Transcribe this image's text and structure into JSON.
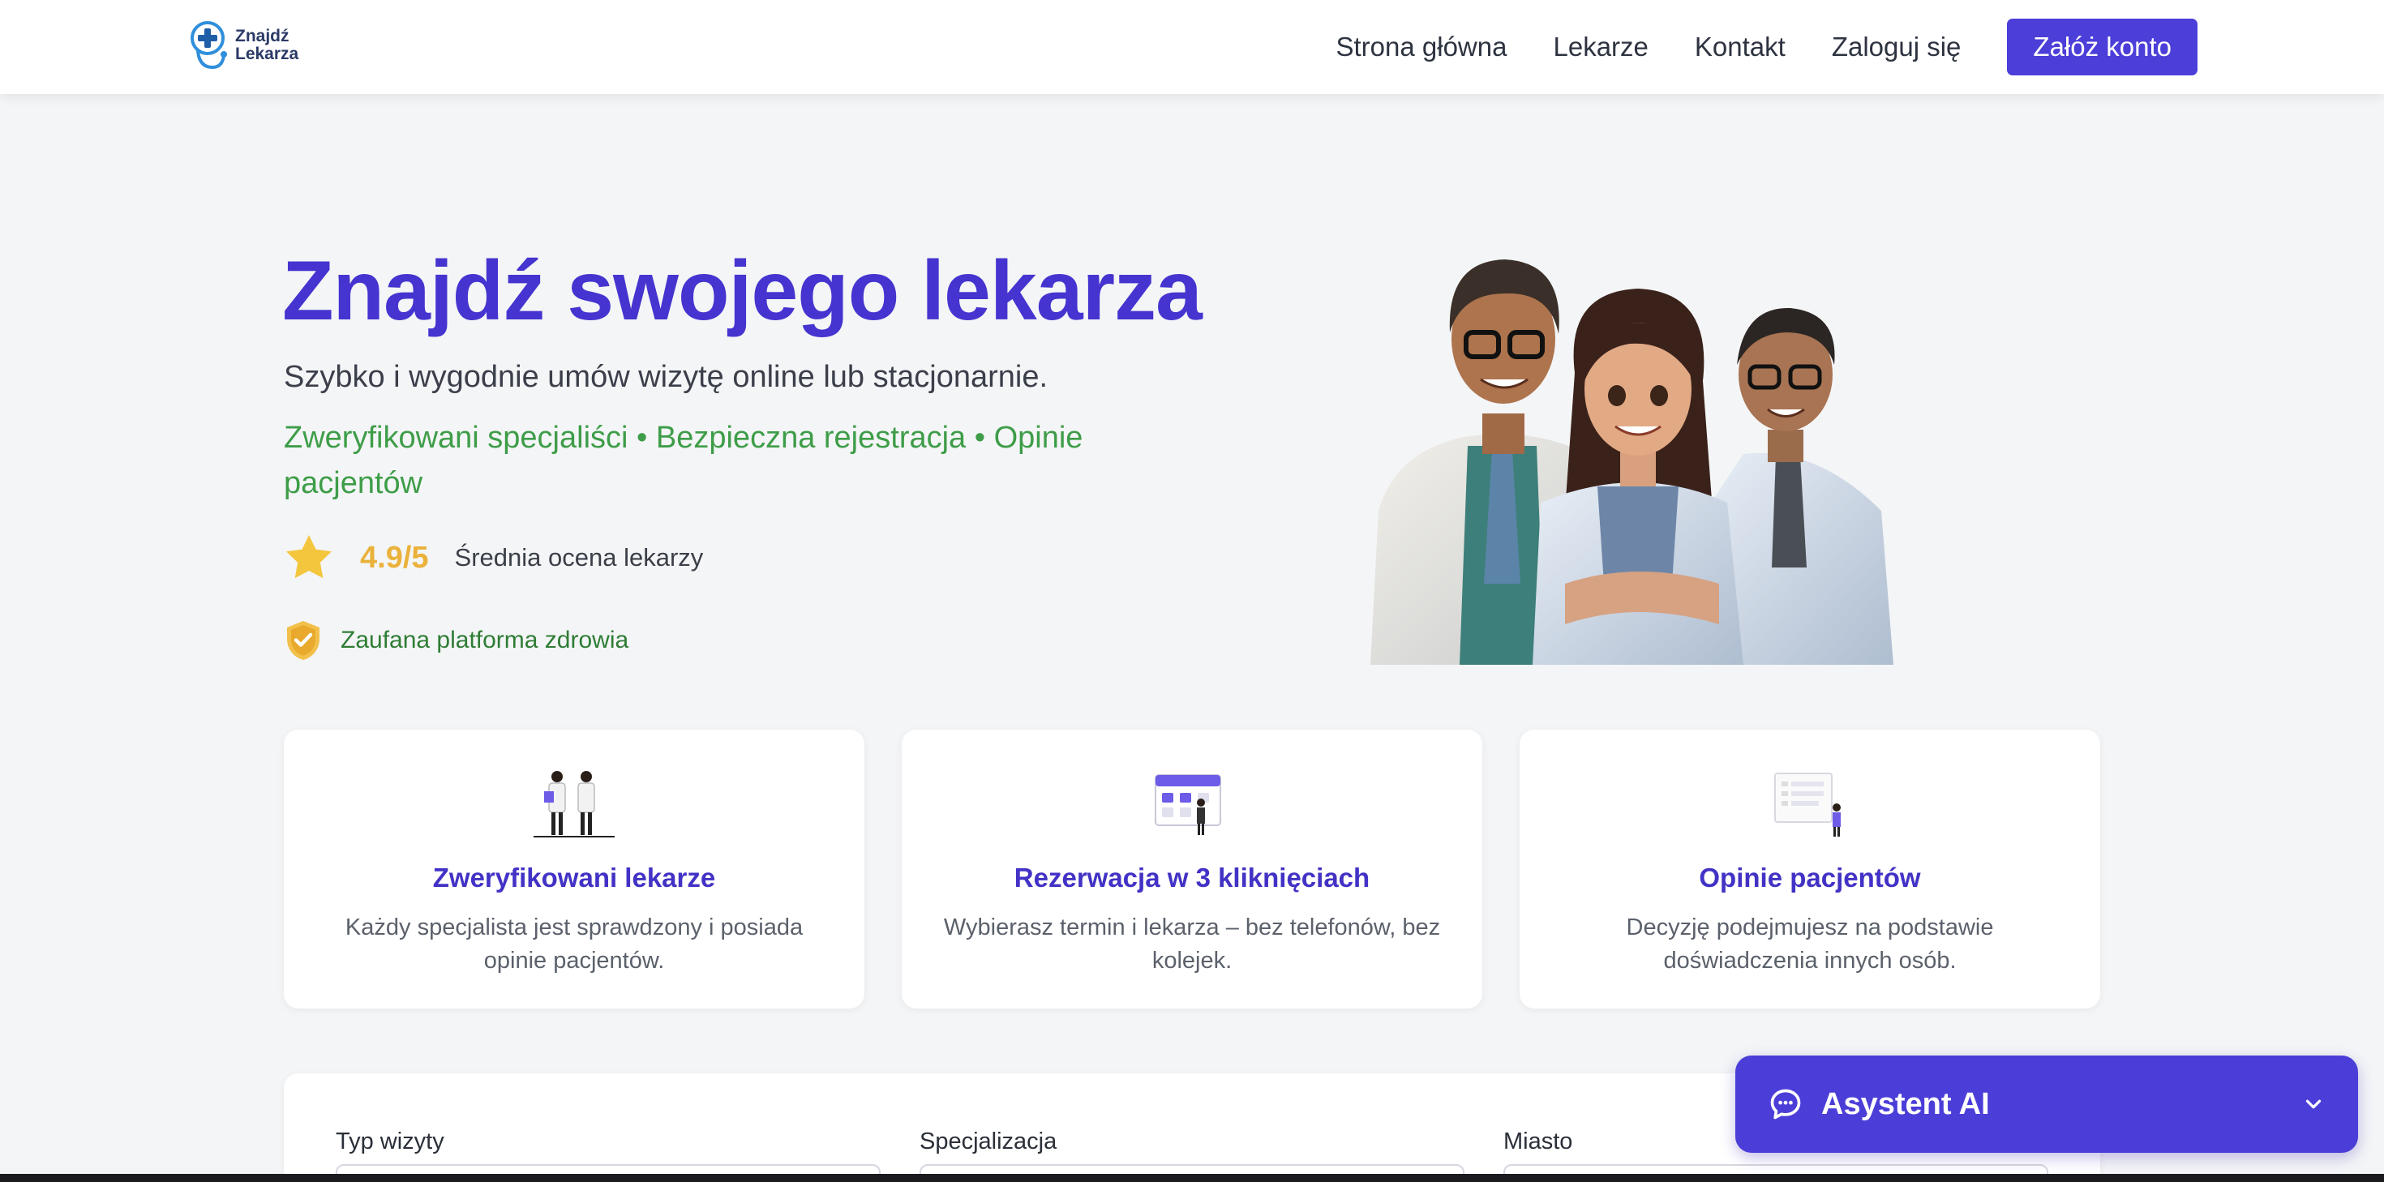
{
  "header": {
    "logo_line1": "Znajdź",
    "logo_line2": "Lekarza",
    "nav": [
      "Strona główna",
      "Lekarze",
      "Kontakt",
      "Zaloguj się"
    ],
    "cta": "Załóż konto"
  },
  "hero": {
    "title": "Znajdź swojego lekarza",
    "subtitle": "Szybko i wygodnie umów wizytę online lub stacjonarnie.",
    "features": "Zweryfikowani specjaliści • Bezpieczna rejestracja • Opinie pacjentów",
    "rating_value": "4.9/5",
    "rating_label": "Średnia ocena lekarzy",
    "trust_label": "Zaufana platforma zdrowia"
  },
  "cards": [
    {
      "title": "Zweryfikowani lekarze",
      "desc": "Każdy specjalista jest sprawdzony i posiada opinie pacjentów."
    },
    {
      "title": "Rezerwacja w 3 kliknięciach",
      "desc": "Wybierasz termin i lekarza – bez telefonów, bez kolejek."
    },
    {
      "title": "Opinie pacjentów",
      "desc": "Decyzję podejmujesz na podstawie doświadczenia innych osób."
    }
  ],
  "search": {
    "fields": [
      "Typ wizyty",
      "Specjalizacja",
      "Miasto"
    ]
  },
  "assistant": {
    "label": "Asystent AI"
  },
  "colors": {
    "brand": "#4b3ed8",
    "title": "#4534cf",
    "green": "#3e9d48",
    "star": "#f4c63d"
  }
}
